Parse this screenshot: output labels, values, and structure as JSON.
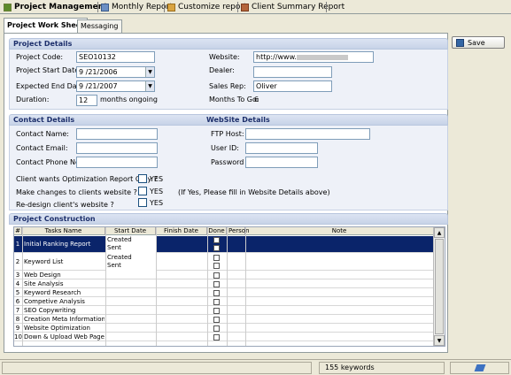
{
  "tabs": [
    "Project Management",
    "Monthly Report",
    "Customize report",
    "Client Summary Report"
  ],
  "subtabs": [
    "Project Work Sheet",
    "Messaging"
  ],
  "save_label": "Save",
  "project_details": {
    "title": "Project Details",
    "code_label": "Project Code:",
    "code_value": "SEO10132",
    "start_label": "Project Start Date:",
    "start_value": "9 /21/2006",
    "expected_label": "Expected End Date:",
    "expected_value": "9 /21/2007",
    "duration_label": "Duration:",
    "duration_value": "12",
    "duration_unit": "months ongoing",
    "website_label": "Website:",
    "website_value": "http://www.",
    "dealer_label": "Dealer:",
    "dealer_value": "",
    "salesrep_label": "Sales Rep:",
    "salesrep_value": "Oliver",
    "months_label": "Months To Go:",
    "months_value": "6"
  },
  "contact_details": {
    "title": "Contact Details",
    "name_label": "Contact Name:",
    "email_label": "Contact Email:",
    "phone_label": "Contact Phone No:"
  },
  "website_details": {
    "title": "WebSite Details",
    "ftp_label": "FTP Host:",
    "user_label": "User ID:",
    "password_label": "Password"
  },
  "questions": {
    "q1": "Client wants Optimization Report Only ?",
    "q2": "Make changes to clients website ?",
    "q3": "Re-design client's website ?",
    "yes": "YES",
    "note": "(If Yes, Please fill in Website Details above)"
  },
  "construction": {
    "title": "Project Construction",
    "headers": [
      "#",
      "Tasks Name",
      "Start Date",
      "Finish Date",
      "Done",
      "Person",
      "Note"
    ],
    "rows": [
      {
        "num": "1",
        "name": "Initial Ranking Report",
        "start": [
          "Created",
          "Sent"
        ]
      },
      {
        "num": "2",
        "name": "Keyword List",
        "start": [
          "Created",
          "Sent"
        ]
      },
      {
        "num": "3",
        "name": "Web Design",
        "start": []
      },
      {
        "num": "4",
        "name": "Site Analysis",
        "start": []
      },
      {
        "num": "5",
        "name": "Keyword Research",
        "start": []
      },
      {
        "num": "6",
        "name": "Competive Analysis",
        "start": []
      },
      {
        "num": "7",
        "name": "SEO Copywriting",
        "start": []
      },
      {
        "num": "8",
        "name": "Creation Meta Information",
        "start": []
      },
      {
        "num": "9",
        "name": "Website Optimization",
        "start": []
      },
      {
        "num": "10",
        "name": "Down & Upload Web Pages",
        "start": []
      }
    ]
  },
  "status": {
    "keywords": "155 keywords"
  }
}
